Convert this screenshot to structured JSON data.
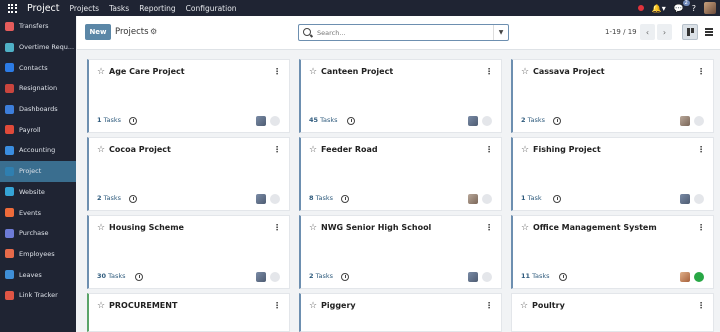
{
  "app": {
    "brand": "Project"
  },
  "topmenu": [
    "Projects",
    "Tasks",
    "Reporting",
    "Configuration"
  ],
  "topbar_badge": "2",
  "sidebar": {
    "items": [
      {
        "label": "Transfers",
        "color": "#e55c5c"
      },
      {
        "label": "Overtime Requ...",
        "color": "#4fb0c6"
      },
      {
        "label": "Contacts",
        "color": "#2c7be5"
      },
      {
        "label": "Resignation",
        "color": "#c9453e"
      },
      {
        "label": "Dashboards",
        "color": "#3d7edb"
      },
      {
        "label": "Payroll",
        "color": "#e04a3a"
      },
      {
        "label": "Accounting",
        "color": "#3a8de0"
      },
      {
        "label": "Project",
        "color": "#2f7fb0",
        "active": true
      },
      {
        "label": "Website",
        "color": "#35a4d6"
      },
      {
        "label": "Events",
        "color": "#ee6b3a"
      },
      {
        "label": "Purchase",
        "color": "#6d7bd6"
      },
      {
        "label": "Employees",
        "color": "#e66a4a"
      },
      {
        "label": "Leaves",
        "color": "#3f8fd8"
      },
      {
        "label": "Link Tracker",
        "color": "#e05545"
      }
    ]
  },
  "control": {
    "new_label": "New",
    "breadcrumb": "Projects",
    "search_placeholder": "Search...",
    "pager": "1-19 / 19"
  },
  "projects": [
    {
      "title": "Age Care Project",
      "count": "1",
      "tasks_word": "Tasks",
      "avatar": "default",
      "status": "grey"
    },
    {
      "title": "Canteen Project",
      "count": "45",
      "tasks_word": "Tasks",
      "avatar": "default",
      "status": "grey"
    },
    {
      "title": "Cassava Project",
      "count": "2",
      "tasks_word": "Tasks",
      "avatar": "photo",
      "status": "grey"
    },
    {
      "title": "Cocoa Project",
      "count": "2",
      "tasks_word": "Tasks",
      "avatar": "default",
      "status": "grey"
    },
    {
      "title": "Feeder Road",
      "count": "8",
      "tasks_word": "Tasks",
      "avatar": "photo",
      "status": "grey"
    },
    {
      "title": "Fishing Project",
      "count": "1",
      "tasks_word": "Task",
      "avatar": "default",
      "status": "grey"
    },
    {
      "title": "Housing Scheme",
      "count": "30",
      "tasks_word": "Tasks",
      "avatar": "default",
      "status": "grey"
    },
    {
      "title": "NWG Senior High School",
      "count": "2",
      "tasks_word": "Tasks",
      "avatar": "default",
      "status": "grey"
    },
    {
      "title": "Office Management System",
      "count": "11",
      "tasks_word": "Tasks",
      "avatar": "orange",
      "status": "green"
    },
    {
      "title": "PROCUREMENT",
      "count": "",
      "tasks_word": "",
      "avatar": "",
      "status": ""
    },
    {
      "title": "Piggery",
      "count": "",
      "tasks_word": "",
      "avatar": "",
      "status": ""
    },
    {
      "title": "Poultry",
      "count": "",
      "tasks_word": "",
      "avatar": "",
      "status": ""
    }
  ]
}
